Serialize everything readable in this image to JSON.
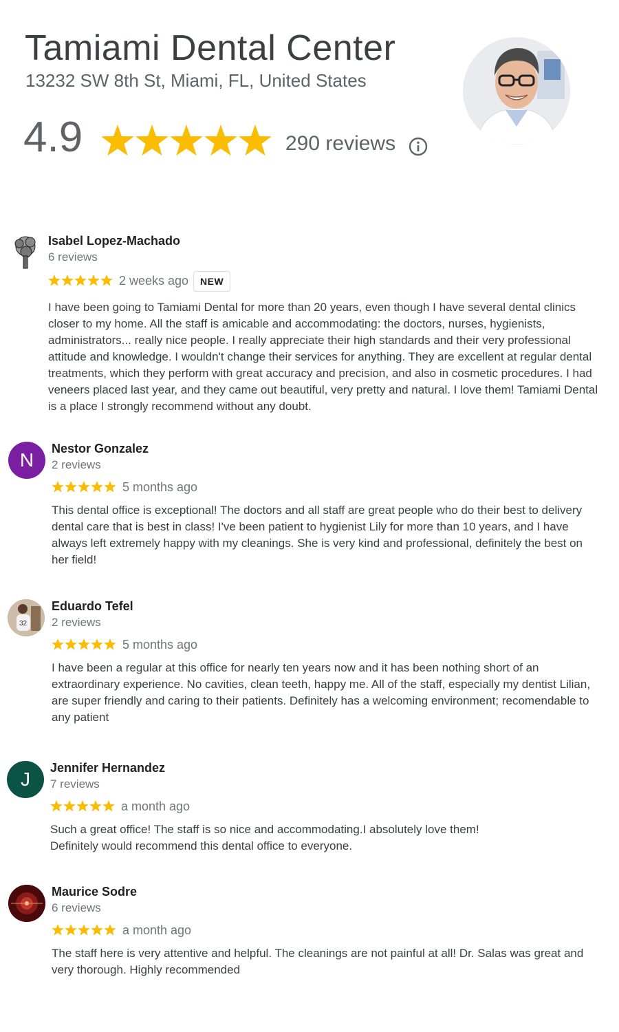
{
  "business": {
    "name": "Tamiami Dental Center",
    "address": "13232 SW 8th St, Miami, FL, United States",
    "rating": "4.9",
    "review_count": "290 reviews",
    "star_count": 5,
    "star_color": "#fbbc04"
  },
  "icons": {
    "info": "info-circle-icon",
    "star": "star-icon",
    "profile_photo": "dentist-photo"
  },
  "reviews": [
    {
      "name": "Isabel Lopez-Machado",
      "count": "6 reviews",
      "time": "2 weeks ago",
      "badge": "NEW",
      "rating": 5,
      "text": "I have been going to Tamiami Dental for more than 20 years, even though I have several dental clinics closer to my home. All the staff is amicable and accommodating: the doctors, nurses, hygienists, administrators... really nice people. I really appreciate their high standards and their very professional attitude and knowledge. I wouldn't change their services for anything. They are excellent at regular dental treatments, which they perform with great accuracy and precision, and also in cosmetic procedures. I had veneers placed last year, and they came out beautiful, very pretty and natural. I love them! Tamiami Dental is a place I strongly recommend without any doubt."
    },
    {
      "name": "Nestor Gonzalez",
      "count": "2 reviews",
      "time": "5 months ago",
      "avatar_letter": "N",
      "avatar_color": "#7b1fa2",
      "rating": 5,
      "text": "This dental office is exceptional! The doctors and all staff are great people who do their best to delivery dental care that is best in class! I've been patient to hygienist Lily for more than 10 years, and I have always left extremely happy with my cleanings. She is very kind and professional, definitely the best on her field!"
    },
    {
      "name": "Eduardo Tefel",
      "count": "2 reviews",
      "time": "5 months ago",
      "rating": 5,
      "text": "I have been a regular at this office for nearly ten years now and it has been nothing short of an extraordinary experience. No cavities, clean teeth, happy me. All of the staff, especially my dentist Lilian, are super friendly and caring to their patients. Definitely has a welcoming environment; recomendable to any patient"
    },
    {
      "name": "Jennifer Hernandez",
      "count": "7 reviews",
      "time": "a month ago",
      "avatar_letter": "J",
      "avatar_color": "#0b5345",
      "rating": 5,
      "text": "Such a great office!  The staff is so nice and accommodating.I absolutely love them!\nDefinitely would recommend this dental office to everyone."
    },
    {
      "name": "Maurice Sodre",
      "count": "6 reviews",
      "time": "a month ago",
      "rating": 5,
      "text": "The staff here is very attentive and helpful. The cleanings are not painful at all! Dr. Salas was great and very thorough. Highly recommended"
    }
  ]
}
